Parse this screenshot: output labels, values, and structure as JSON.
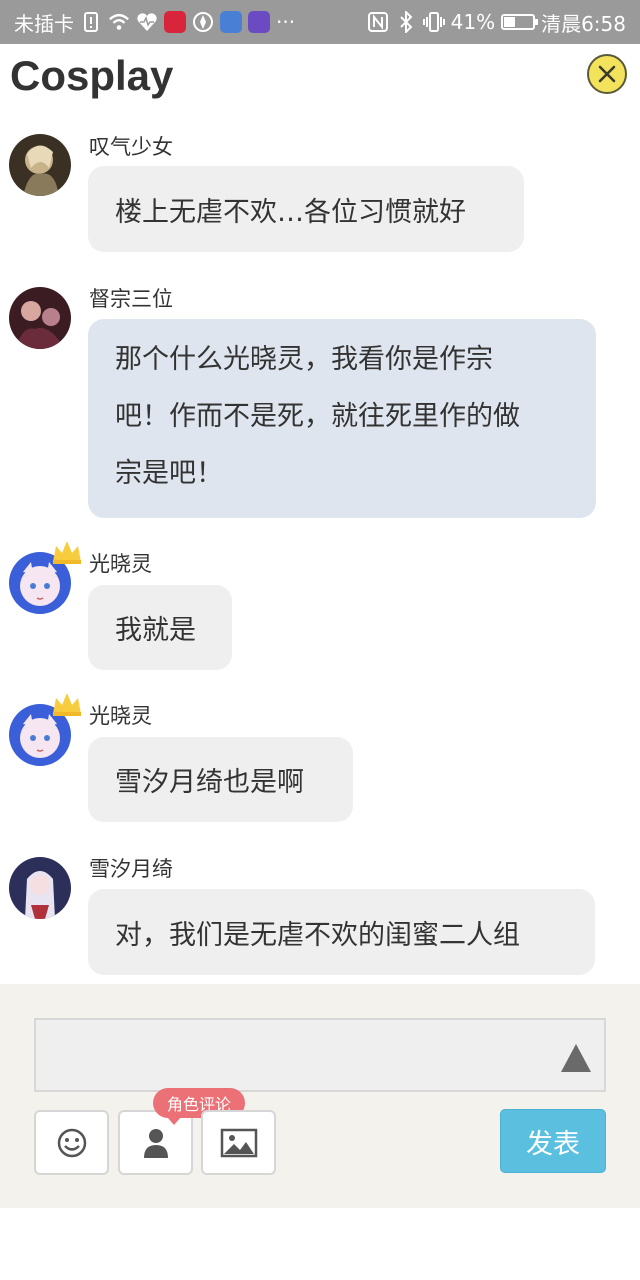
{
  "status_bar": {
    "carrier": "未插卡",
    "battery_text": "41%",
    "battery_level": 0.41,
    "time": "清晨6:58",
    "more": "···",
    "icons": [
      "sim-alert-icon",
      "wifi-icon",
      "health-icon",
      "app-red-icon",
      "app-compass-icon",
      "app-music-icon",
      "app-purple-icon",
      "nfc-icon",
      "bluetooth-icon",
      "vibrate-icon",
      "battery-icon"
    ]
  },
  "header": {
    "title": "Cosplay",
    "close_icon": "close-icon",
    "accent": "#f3e35c"
  },
  "messages": [
    {
      "user": "叹气少女",
      "lines": [
        "楼上无虐不欢…各位习惯就好"
      ],
      "crown": false
    },
    {
      "user": "督宗三位",
      "lines": [
        "那个什么光晓灵，我看你是作宗",
        "吧！作而不是死，就往死里作的做",
        "宗是吧！"
      ],
      "crown": false
    },
    {
      "user": "光晓灵",
      "lines": [
        "我就是"
      ],
      "crown": true
    },
    {
      "user": "光晓灵",
      "lines": [
        "雪汐月绮也是啊"
      ],
      "crown": true
    },
    {
      "user": "雪汐月绮",
      "lines": [
        "对，我们是无虐不欢的闺蜜二人组"
      ],
      "crown": false
    }
  ],
  "composer": {
    "input_value": "",
    "send_icon": "send-triangle-icon",
    "role_tag": "角色评论",
    "tools": [
      "emoji-icon",
      "person-icon",
      "image-icon"
    ],
    "publish_label": "发表",
    "publish_color": "#5bc0e0"
  }
}
